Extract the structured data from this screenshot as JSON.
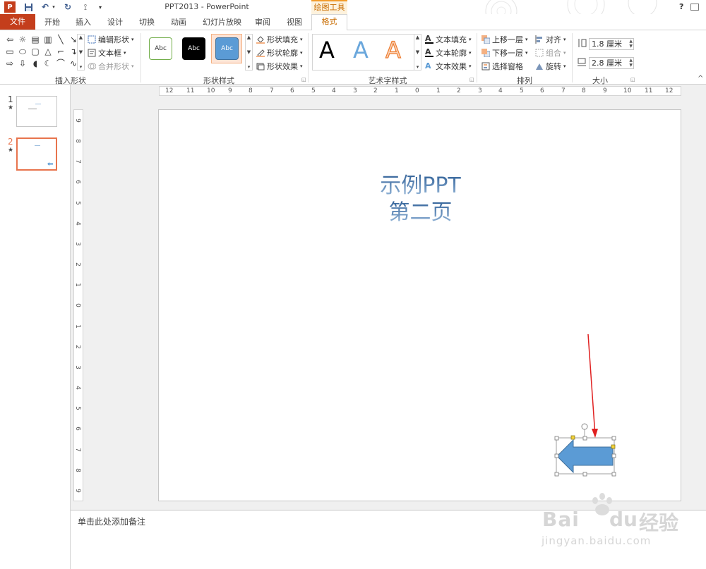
{
  "app": {
    "title": "PPT2013 - PowerPoint",
    "context_tool": "绘图工具",
    "help": "?"
  },
  "tabs": {
    "file": "文件",
    "items": [
      "开始",
      "插入",
      "设计",
      "切换",
      "动画",
      "幻灯片放映",
      "审阅",
      "视图"
    ],
    "active": "格式"
  },
  "ribbon": {
    "insert_shapes": {
      "label": "插入形状",
      "edit_shape": "编辑形状",
      "text_box": "文本框",
      "merge_shapes": "合并形状"
    },
    "shape_styles": {
      "label": "形状样式",
      "sample": "Abc",
      "fill": "形状填充",
      "outline": "形状轮廓",
      "effects": "形状效果"
    },
    "wordart": {
      "label": "艺术字样式",
      "sample": "A",
      "text_fill": "文本填充",
      "text_outline": "文本轮廓",
      "text_effects": "文本效果"
    },
    "arrange": {
      "label": "排列",
      "bring_forward": "上移一层",
      "send_backward": "下移一层",
      "selection_pane": "选择窗格",
      "align": "对齐",
      "group": "组合",
      "rotate": "旋转"
    },
    "size": {
      "label": "大小",
      "height": "1.8 厘米",
      "width": "2.8 厘米"
    }
  },
  "thumbnails": [
    {
      "num": "1",
      "star": "★"
    },
    {
      "num": "2",
      "star": "★"
    }
  ],
  "ruler": {
    "h_ticks": [
      "12",
      "11",
      "10",
      "9",
      "8",
      "7",
      "6",
      "5",
      "4",
      "3",
      "2",
      "1",
      "0",
      "1",
      "2",
      "3",
      "4",
      "5",
      "6",
      "7",
      "8",
      "9",
      "10",
      "11",
      "12"
    ],
    "v_ticks": [
      "9",
      "8",
      "7",
      "6",
      "5",
      "4",
      "3",
      "2",
      "1",
      "0",
      "1",
      "2",
      "3",
      "4",
      "5",
      "6",
      "7",
      "8",
      "9"
    ]
  },
  "slide": {
    "title_line1": "示例PPT",
    "title_line2": "第二页"
  },
  "notes": {
    "placeholder": "单击此处添加备注"
  },
  "watermark": {
    "brand_latin_1": "Bai",
    "brand_latin_2": "du",
    "brand_cn": "经验",
    "url": "jingyan.baidu.com"
  },
  "colors": {
    "accent": "#c43e1c",
    "context": "#f29b2a",
    "arrow_fill": "#5b9bd5",
    "annotation": "#e02020"
  }
}
